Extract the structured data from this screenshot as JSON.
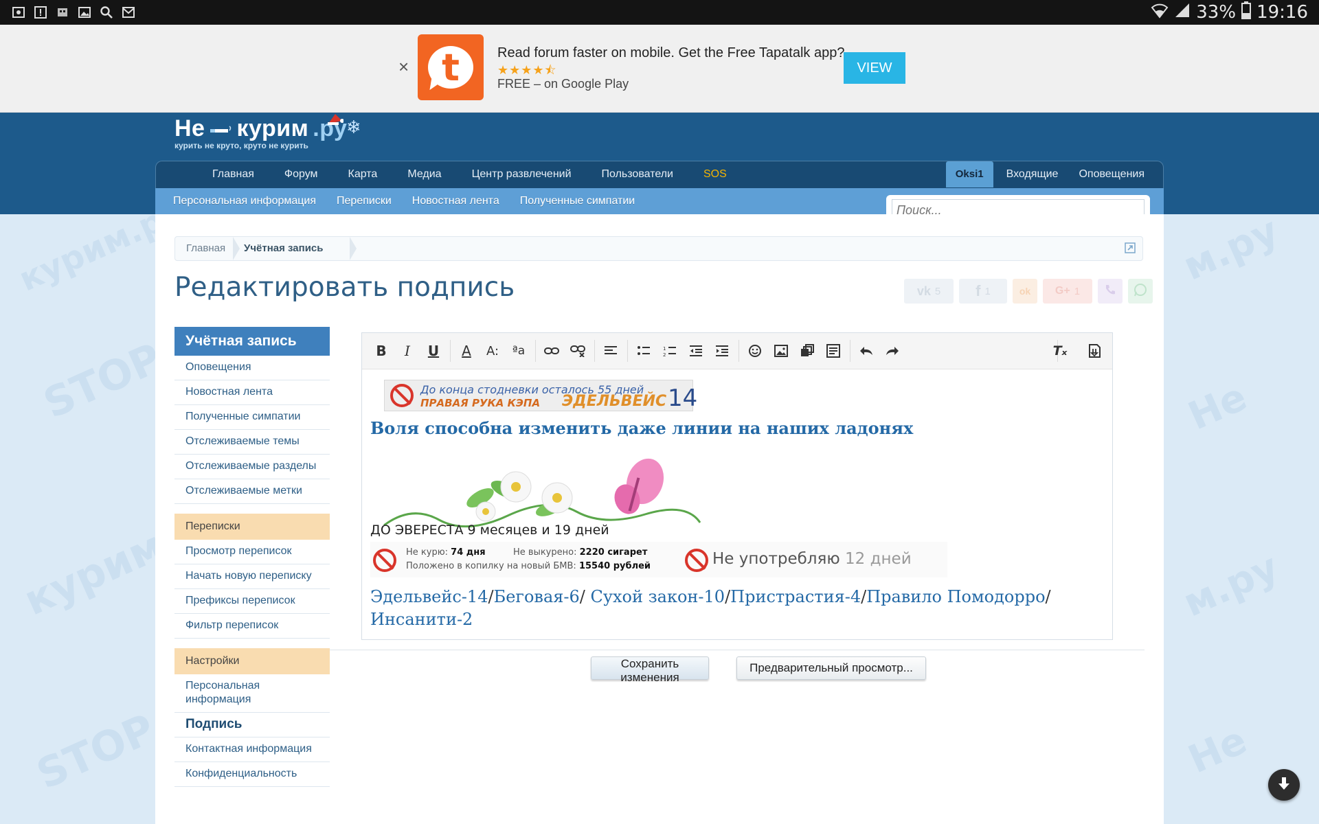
{
  "status_bar": {
    "battery": "33%",
    "time": "19:16",
    "left_icons": [
      "screenshot-icon",
      "notification-icon",
      "usb-icon",
      "gallery-icon",
      "search-icon",
      "mail-icon"
    ]
  },
  "ad": {
    "close": "×",
    "logo_letter": "t",
    "title": "Read forum faster on mobile. Get the Free Tapatalk app?",
    "stars": "★★★★⯪",
    "subtitle": "FREE – on Google Play",
    "view_label": "VIEW"
  },
  "logo": {
    "main_left": "Не",
    "main_right": "курим",
    "main_suffix": ".ру",
    "tagline": "курить не круто, круто не курить"
  },
  "nav": {
    "tabs": [
      "Главная",
      "Форум",
      "Карта",
      "Медиа",
      "Центр развлечений",
      "Пользователи",
      "SOS"
    ],
    "user": "Oksi1",
    "inbox": "Входящие",
    "alerts": "Оповещения"
  },
  "subnav": {
    "links": [
      "Персональная информация",
      "Переписки",
      "Новостная лента",
      "Полученные симпатии"
    ]
  },
  "search": {
    "placeholder": "Поиск..."
  },
  "breadcrumb": {
    "home": "Главная",
    "current": "Учётная запись"
  },
  "page_title": "Редактировать подпись",
  "share": {
    "vk_count": "5",
    "fb_count": "1",
    "gplus_count": "1",
    "vk_label": "vk",
    "fb_label": "f",
    "ok_label": "ok",
    "gplus_label": "G+"
  },
  "sidebar": {
    "heading": "Учётная запись",
    "group1": [
      "Оповещения",
      "Новостная лента",
      "Полученные симпатии",
      "Отслеживаемые темы",
      "Отслеживаемые разделы",
      "Отслеживаемые метки"
    ],
    "section2": "Переписки",
    "group2": [
      "Просмотр переписок",
      "Начать новую переписку",
      "Префиксы переписок",
      "Фильтр переписок"
    ],
    "section3": "Настройки",
    "group3": [
      "Персональная информация",
      "Подпись",
      "Контактная информация",
      "Конфиденциальность"
    ]
  },
  "signature": {
    "userbar1_top": "До конца стодневки осталось 55 дней",
    "userbar1_bottom": "ПРАВАЯ РУКА КЭПА",
    "userbar1_brand": "ЭДЕЛЬВЕЙС",
    "userbar1_number": "14",
    "quote": "Воля способна изменить даже линии на наших ладонях",
    "everest": "ДО ЭВЕРЕСТА 9 месяцев и 19 дней",
    "counter_not_smoking_label": "Не курю:",
    "counter_not_smoking_value": "74 дня",
    "counter_not_smoked_label": "Не выкурено:",
    "counter_not_smoked_value": "2220 сигарет",
    "counter_piggy_label": "Положено в копилку на новый БМВ:",
    "counter_piggy_value": "15540 рублей",
    "not_using_label": "Не употребляю",
    "not_using_days": "12 дней",
    "links_line1": [
      {
        "text": "Эдельвейс-14",
        "sep": "/"
      },
      {
        "text": "Беговая-6",
        "sep": "/ "
      },
      {
        "text": "Сухой закон-10",
        "sep": "/"
      },
      {
        "text": "Пристрастия-4",
        "sep": "/"
      },
      {
        "text": "Правило Помодорро",
        "sep": "/"
      }
    ],
    "links_line2": "Инсанити-2"
  },
  "buttons": {
    "save": "Сохранить изменения",
    "preview": "Предварительный просмотр..."
  },
  "colors": {
    "header_blue": "#1d5a8b",
    "subnav_blue": "#5e9fd6",
    "link_blue": "#2469a6",
    "section_orange": "#f9dcb0",
    "sos_yellow": "#f5b400",
    "tapatalk_orange": "#f26522",
    "view_button": "#29b5e5"
  }
}
